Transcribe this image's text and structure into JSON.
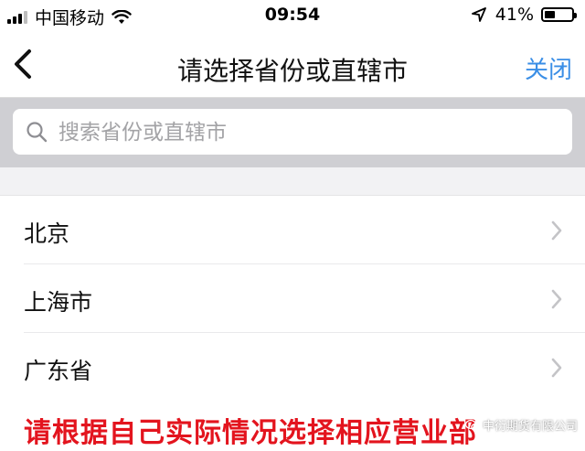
{
  "status_bar": {
    "carrier": "中国移动",
    "time": "09:54",
    "battery_percent": "41%",
    "battery_level": 0.41
  },
  "nav": {
    "title": "请选择省份或直辖市",
    "close_label": "关闭"
  },
  "search": {
    "placeholder": "搜索省份或直辖市",
    "value": ""
  },
  "regions": [
    {
      "label": "北京"
    },
    {
      "label": "上海市"
    },
    {
      "label": "广东省"
    }
  ],
  "banner": {
    "text": "请根据自己实际情况选择相应营业部"
  },
  "watermark": {
    "text": "中衍期货有限公司"
  },
  "colors": {
    "accent": "#3a8ee6",
    "banner_red": "#e3141e",
    "search_bg": "#cfcfd3"
  }
}
